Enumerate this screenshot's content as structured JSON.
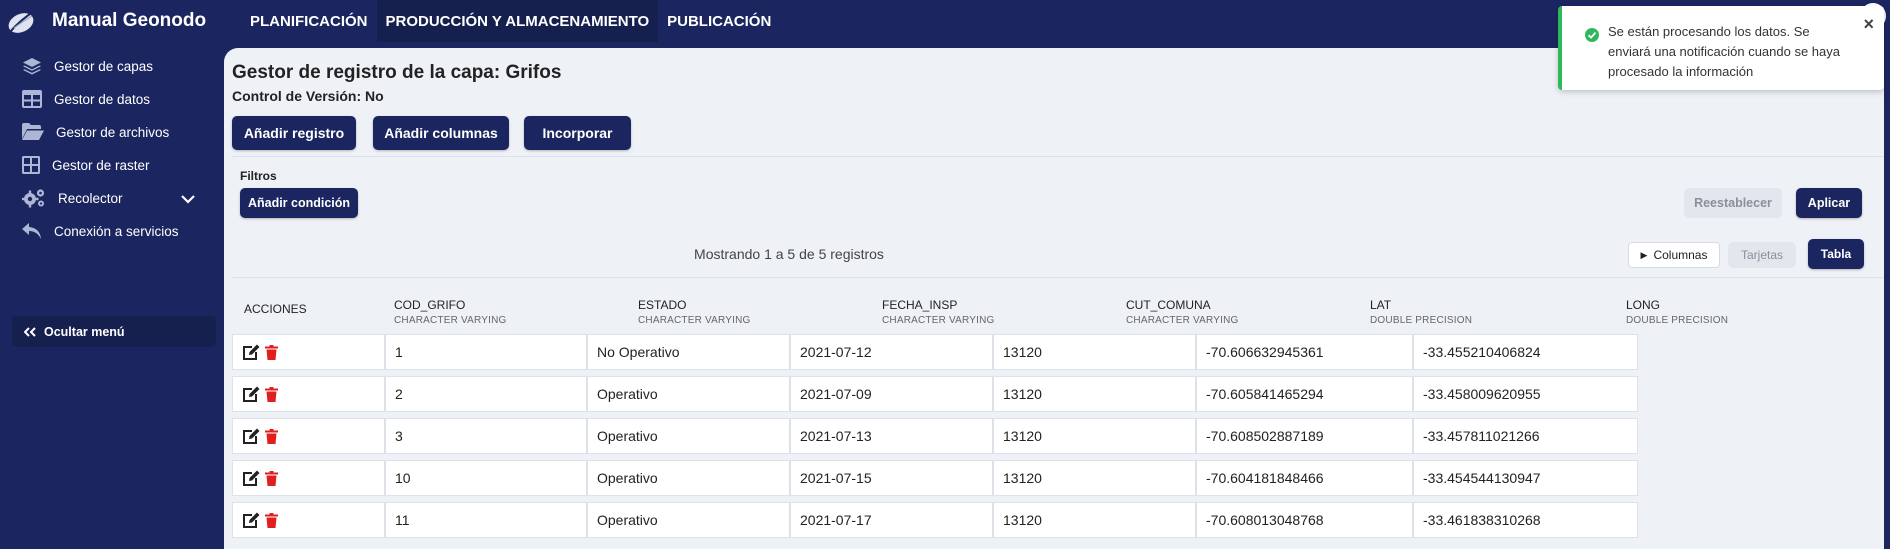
{
  "app": {
    "brand": "Manual Geonodo"
  },
  "topnav": [
    {
      "label": "PLANIFICACIÓN"
    },
    {
      "label": "PRODUCCIÓN Y ALMACENAMIENTO"
    },
    {
      "label": "PUBLICACIÓN"
    }
  ],
  "sidebar": {
    "items": [
      {
        "label": "Gestor de capas",
        "icon": "layers-icon"
      },
      {
        "label": "Gestor de datos",
        "icon": "table-icon"
      },
      {
        "label": "Gestor de archivos",
        "icon": "folder-open-icon"
      },
      {
        "label": "Gestor de raster",
        "icon": "grid-icon"
      },
      {
        "label": "Recolector",
        "icon": "gears-icon"
      },
      {
        "label": "Conexión a servicios",
        "icon": "reply-arrow-icon"
      }
    ],
    "hide_menu": "Ocultar menú"
  },
  "main": {
    "title": "Gestor de registro de la capa: Grifos",
    "version": "Control de Versión: No",
    "buttons": {
      "add_record": "Añadir registro",
      "add_columns": "Añadir columnas",
      "incorporate": "Incorporar"
    },
    "filters": {
      "label": "Filtros",
      "add_condition": "Añadir condición",
      "reset": "Reestablecer",
      "apply": "Aplicar"
    },
    "showing": "Mostrando 1 a 5 de 5 registros",
    "view": {
      "columns": "Columnas",
      "cards": "Tarjetas",
      "table": "Tabla"
    }
  },
  "table": {
    "actions_header": "ACCIONES",
    "columns": [
      {
        "name": "COD_GRIFO",
        "type": "CHARACTER VARYING"
      },
      {
        "name": "ESTADO",
        "type": "CHARACTER VARYING"
      },
      {
        "name": "FECHA_INSP",
        "type": "CHARACTER VARYING"
      },
      {
        "name": "CUT_COMUNA",
        "type": "CHARACTER VARYING"
      },
      {
        "name": "LAT",
        "type": "DOUBLE PRECISION"
      },
      {
        "name": "LONG",
        "type": "DOUBLE PRECISION"
      }
    ],
    "rows": [
      [
        "1",
        "No Operativo",
        "2021-07-12",
        "13120",
        "-70.606632945361",
        "-33.455210406824"
      ],
      [
        "2",
        "Operativo",
        "2021-07-09",
        "13120",
        "-70.605841465294",
        "-33.458009620955"
      ],
      [
        "3",
        "Operativo",
        "2021-07-13",
        "13120",
        "-70.608502887189",
        "-33.457811021266"
      ],
      [
        "10",
        "Operativo",
        "2021-07-15",
        "13120",
        "-70.604181848466",
        "-33.454544130947"
      ],
      [
        "11",
        "Operativo",
        "2021-07-17",
        "13120",
        "-70.608013048768",
        "-33.461838310268"
      ]
    ]
  },
  "toast": {
    "message": "Se están procesando los datos. Se enviará una notificación cuando se haya procesado la información",
    "close": "×"
  },
  "colors": {
    "navy": "#1b2660",
    "navy_dark": "#16204f",
    "success": "#2eb85c",
    "delete": "#e02020",
    "panel": "#eef1f6"
  }
}
